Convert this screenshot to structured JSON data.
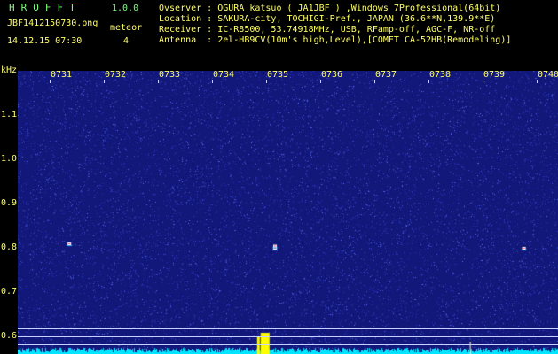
{
  "app": {
    "title": "HROFFT",
    "version": "1.0.0"
  },
  "file_name": "JBF1412150730.png",
  "meteor_label": "meteor",
  "meteor_count": "4",
  "datetime": "14.12.15 07:30",
  "info_lines": [
    "Ovserver : OGURA katsuo ( JA1JBF ) ,Windows 7Professional(64bit)",
    "Location : SAKURA-city, TOCHIGI-Pref., JAPAN (36.6**N,139.9**E)",
    "Receiver : IC-R8500, 53.74918MHz, USB, RFamp-off, AGC-F, NR-off",
    "Antenna  : 2el-HB9CV(10m's high,Level),[COMET CA-52HB(Remodeling)]"
  ],
  "colors": {
    "label": "#ffff66",
    "title": "#7cff7c",
    "background": "#12187a",
    "signal": "#ffff00",
    "noise": "#00e5ff"
  },
  "chart_data": {
    "type": "heatmap",
    "y_unit": "kHz",
    "x_ticks": [
      "0731",
      "0732",
      "0733",
      "0734",
      "0735",
      "0736",
      "0737",
      "0738",
      "0739",
      "0740"
    ],
    "y_ticks": [
      "1.1",
      "1.0",
      "0.9",
      "0.8",
      "0.7",
      "0.6"
    ],
    "y_values": [
      1.1,
      1.0,
      0.9,
      0.8,
      0.7,
      0.6
    ],
    "ylim": [
      0.58,
      1.2
    ],
    "echoes": [
      {
        "time_min": 0.2,
        "freq_khz": 0.81
      },
      {
        "time_min": 4.0,
        "freq_khz": 0.8
      },
      {
        "time_min": 4.0,
        "freq_khz": 0.805
      },
      {
        "time_min": 8.6,
        "freq_khz": 0.8
      }
    ]
  }
}
